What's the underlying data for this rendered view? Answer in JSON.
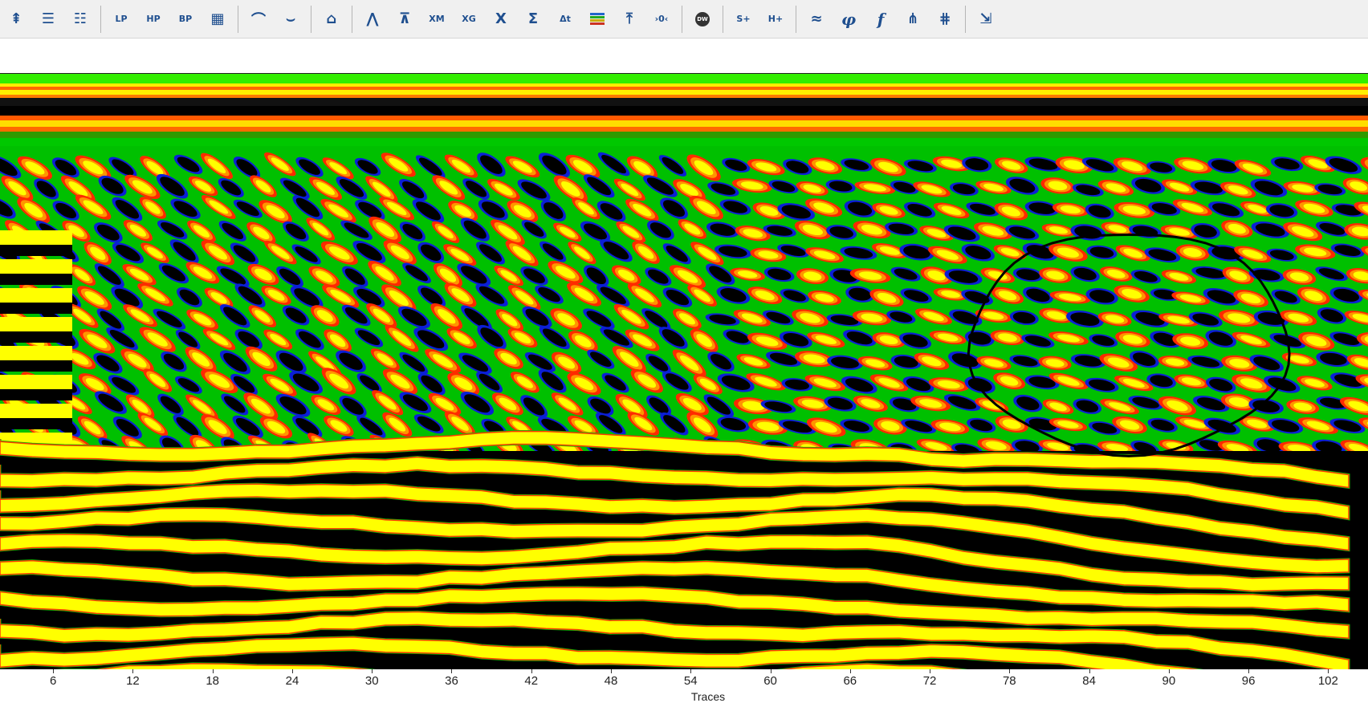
{
  "toolbar": {
    "items": [
      {
        "icon": "filter-top-icon",
        "glyph": "⇞"
      },
      {
        "icon": "filter-lines-icon",
        "glyph": "☰"
      },
      {
        "icon": "filter-dots-icon",
        "glyph": "☷"
      },
      {
        "sep": true
      },
      {
        "icon": "lowpass-filter-icon",
        "glyph": "LP"
      },
      {
        "icon": "highpass-filter-icon",
        "glyph": "HP"
      },
      {
        "icon": "bandpass-filter-icon",
        "glyph": "BP"
      },
      {
        "icon": "grid-icon",
        "glyph": "▦"
      },
      {
        "sep": true
      },
      {
        "icon": "wave-crest-icon",
        "glyph": "⌒"
      },
      {
        "icon": "wave-trough-icon",
        "glyph": "⌣"
      },
      {
        "sep": true
      },
      {
        "icon": "house-icon",
        "glyph": "⌂"
      },
      {
        "sep": true
      },
      {
        "icon": "migration-icon",
        "glyph": "⋀"
      },
      {
        "icon": "hyperbola-icon",
        "glyph": "⊼"
      },
      {
        "icon": "x-m-icon",
        "glyph": "XM"
      },
      {
        "icon": "x-g-icon",
        "glyph": "XG"
      },
      {
        "icon": "x-gps-icon",
        "glyph": "X"
      },
      {
        "icon": "sum-icon",
        "glyph": "Σ"
      },
      {
        "icon": "delta-t-icon",
        "glyph": "Δt"
      },
      {
        "icon": "color-bars-icon",
        "glyph": "bars"
      },
      {
        "icon": "arrow-up-line-icon",
        "glyph": "⤒"
      },
      {
        "icon": "zero-offset-icon",
        "glyph": "›0‹"
      },
      {
        "sep": true
      },
      {
        "icon": "dewow-icon",
        "glyph": "DW"
      },
      {
        "sep": true
      },
      {
        "icon": "s-plus-icon",
        "glyph": "S+"
      },
      {
        "icon": "h-plus-icon",
        "glyph": "H+"
      },
      {
        "sep": true
      },
      {
        "icon": "gain-curve-icon",
        "glyph": "≈"
      },
      {
        "icon": "phi-icon",
        "glyph": "φ"
      },
      {
        "icon": "function-icon",
        "glyph": "f"
      },
      {
        "icon": "waveform-a-icon",
        "glyph": "⋔"
      },
      {
        "icon": "waveform-b-icon",
        "glyph": "⋕"
      },
      {
        "sep": true
      },
      {
        "icon": "export-icon",
        "glyph": "⇲"
      }
    ]
  },
  "chart_data": {
    "type": "heatmap",
    "xlabel": "Traces",
    "x_ticks": [
      "6",
      "12",
      "18",
      "24",
      "30",
      "36",
      "42",
      "48",
      "54",
      "60",
      "66",
      "72",
      "78",
      "84",
      "90",
      "96",
      "102"
    ],
    "x_range": [
      2,
      105
    ],
    "colormap": [
      "#000000",
      "#0b1fd6",
      "#00e000",
      "#ff2a00",
      "#ff9500",
      "#ffff00"
    ],
    "annotation": {
      "shape": "freehand-ellipse",
      "color": "#000000",
      "trace_range": [
        75,
        99
      ]
    }
  }
}
